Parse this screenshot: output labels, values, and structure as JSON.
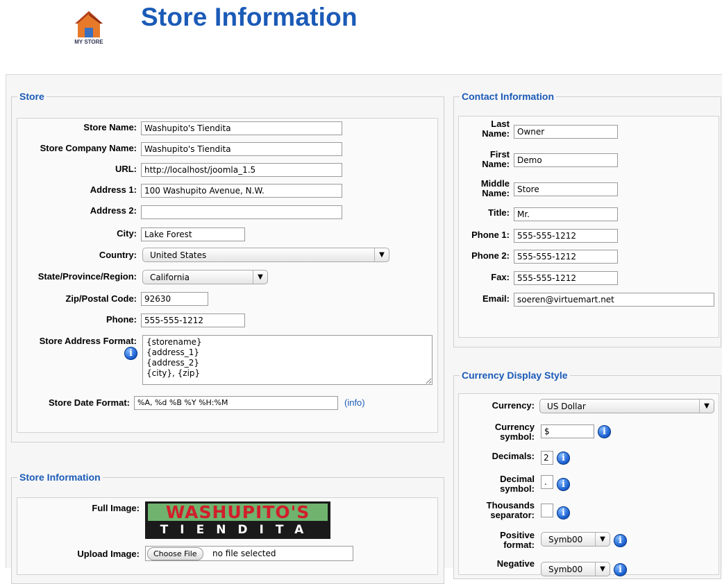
{
  "header": {
    "logo_text": "MY STORE",
    "title": "Store Information"
  },
  "store": {
    "legend": "Store",
    "fields": {
      "store_name": {
        "label": "Store Name:",
        "value": "Washupito's Tiendita"
      },
      "company_name": {
        "label": "Store Company Name:",
        "value": "Washupito's Tiendita"
      },
      "url": {
        "label": "URL:",
        "value": "http://localhost/joomla_1.5"
      },
      "address1": {
        "label": "Address 1:",
        "value": "100 Washupito Avenue, N.W."
      },
      "address2": {
        "label": "Address 2:",
        "value": ""
      },
      "city": {
        "label": "City:",
        "value": "Lake Forest"
      },
      "country": {
        "label": "Country:",
        "value": "United States"
      },
      "state": {
        "label": "State/Province/Region:",
        "value": "California"
      },
      "zip": {
        "label": "Zip/Postal Code:",
        "value": "92630"
      },
      "phone": {
        "label": "Phone:",
        "value": "555-555-1212"
      },
      "address_format": {
        "label": "Store Address Format:",
        "value": "{storename}\n{address_1}\n{address_2}\n{city}, {zip}"
      },
      "date_format": {
        "label": "Store Date Format:",
        "value": "%A, %d %B %Y %H:%M",
        "link": "(info)"
      }
    }
  },
  "store_info": {
    "legend": "Store Information",
    "full_image_label": "Full Image:",
    "image_text_top": "WASHUPITO'S",
    "image_text_bottom": "TIENDITA",
    "upload_label": "Upload Image:",
    "choose_file": "Choose File",
    "no_file": "no file selected"
  },
  "contact": {
    "legend": "Contact Information",
    "last_name": {
      "label_1": "Last",
      "label_2": "Name:",
      "value": "Owner"
    },
    "first_name": {
      "label_1": "First",
      "label_2": "Name:",
      "value": "Demo"
    },
    "middle_name": {
      "label_1": "Middle",
      "label_2": "Name:",
      "value": "Store"
    },
    "title": {
      "label": "Title:",
      "value": "Mr."
    },
    "phone1": {
      "label": "Phone 1:",
      "value": "555-555-1212"
    },
    "phone2": {
      "label": "Phone 2:",
      "value": "555-555-1212"
    },
    "fax": {
      "label": "Fax:",
      "value": "555-555-1212"
    },
    "email": {
      "label": "Email:",
      "value": "soeren@virtuemart.net"
    }
  },
  "currency": {
    "legend": "Currency Display Style",
    "currency": {
      "label": "Currency:",
      "value": "US Dollar"
    },
    "symbol": {
      "label_1": "Currency",
      "label_2": "symbol:",
      "value": "$"
    },
    "decimals": {
      "label": "Decimals:",
      "value": "2"
    },
    "decimal_symbol": {
      "label_1": "Decimal",
      "label_2": "symbol:",
      "value": "."
    },
    "thousands": {
      "label_1": "Thousands",
      "label_2": "separator:",
      "value": ""
    },
    "positive": {
      "label_1": "Positive",
      "label_2": "format:",
      "value": "Symb00"
    },
    "negative": {
      "label_1": "Negative",
      "value": "Symb00"
    }
  },
  "colors": {
    "accent": "#1b5ab7",
    "panel": "#f6f6f6",
    "info_icon": "#1e63d3"
  },
  "icons": {
    "info": "info-icon",
    "dropdown": "chevron-down-icon",
    "logo": "store-logo-icon"
  }
}
